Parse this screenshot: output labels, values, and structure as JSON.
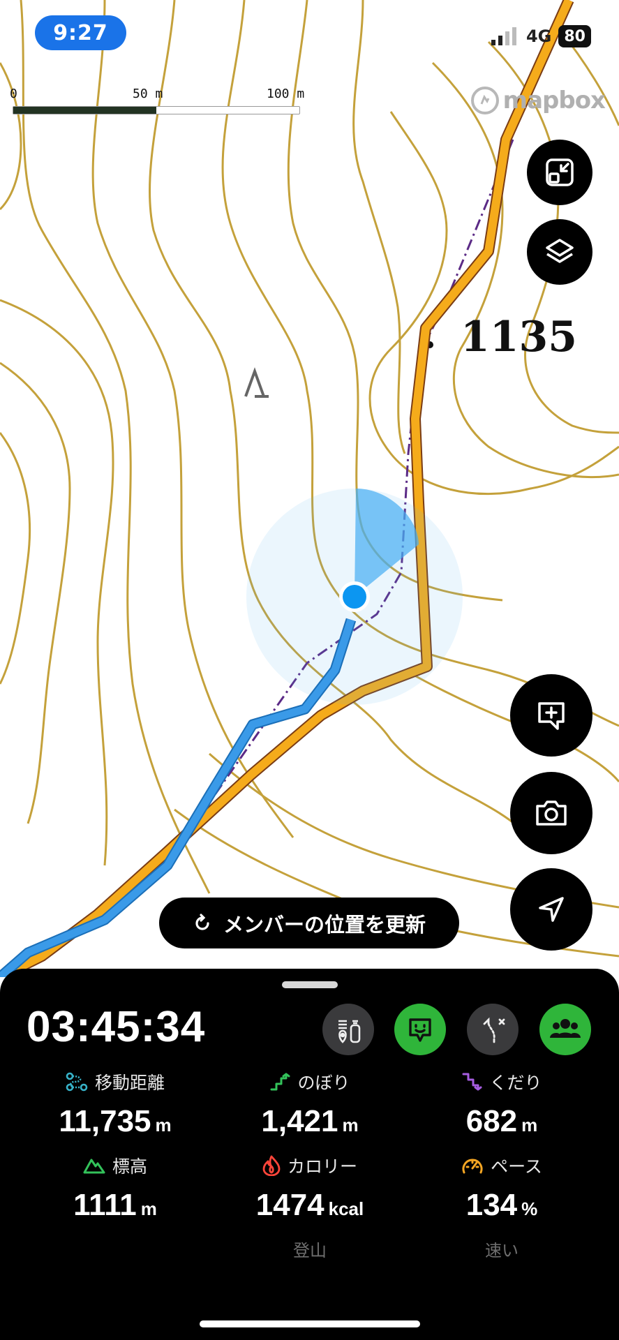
{
  "status_bar": {
    "time": "9:27",
    "network": "4G",
    "battery": "80"
  },
  "scale": {
    "label_0": "0",
    "label_mid": "50 m",
    "label_max": "100 m",
    "fill_fraction": 0.5
  },
  "map": {
    "attribution": "mapbox",
    "peak_elevation": "1135"
  },
  "map_controls": {
    "minimize_icon": "collapse-arrows-icon",
    "layers_icon": "layers-icon",
    "add_comment_icon": "comment-plus-icon",
    "camera_icon": "camera-icon",
    "locate_icon": "navigation-arrow-icon"
  },
  "refresh_members": {
    "label": "メンバーの位置を更新",
    "icon": "refresh-icon"
  },
  "tracker": {
    "elapsed": "03:45:34",
    "tools": [
      {
        "icon": "gear-checklist-icon",
        "color": "#3a3a3c"
      },
      {
        "icon": "signal-face-icon",
        "color": "#2fb53a"
      },
      {
        "icon": "route-icon",
        "color": "#3a3a3c"
      },
      {
        "icon": "group-icon",
        "color": "#2fb53a"
      }
    ],
    "stats": [
      {
        "label": "移動距離",
        "value": "11,735",
        "unit": "m",
        "icon": "distance-icon",
        "icon_color": "#37b2c8"
      },
      {
        "label": "のぼり",
        "value": "1,421",
        "unit": "m",
        "icon": "ascent-icon",
        "icon_color": "#33c25a"
      },
      {
        "label": "くだり",
        "value": "682",
        "unit": "m",
        "icon": "descent-icon",
        "icon_color": "#a65de0"
      },
      {
        "label": "標高",
        "value": "1111",
        "unit": "m",
        "icon": "mountain-icon",
        "icon_color": "#33c25a"
      },
      {
        "label": "カロリー",
        "value": "1474",
        "unit": "kcal",
        "icon": "flame-icon",
        "icon_color": "#ff453a"
      },
      {
        "label": "ペース",
        "value": "134",
        "unit": "%",
        "icon": "speedometer-icon",
        "icon_color": "#f5a623"
      }
    ],
    "calorie_activity": "登山",
    "pace_desc": "速い"
  }
}
